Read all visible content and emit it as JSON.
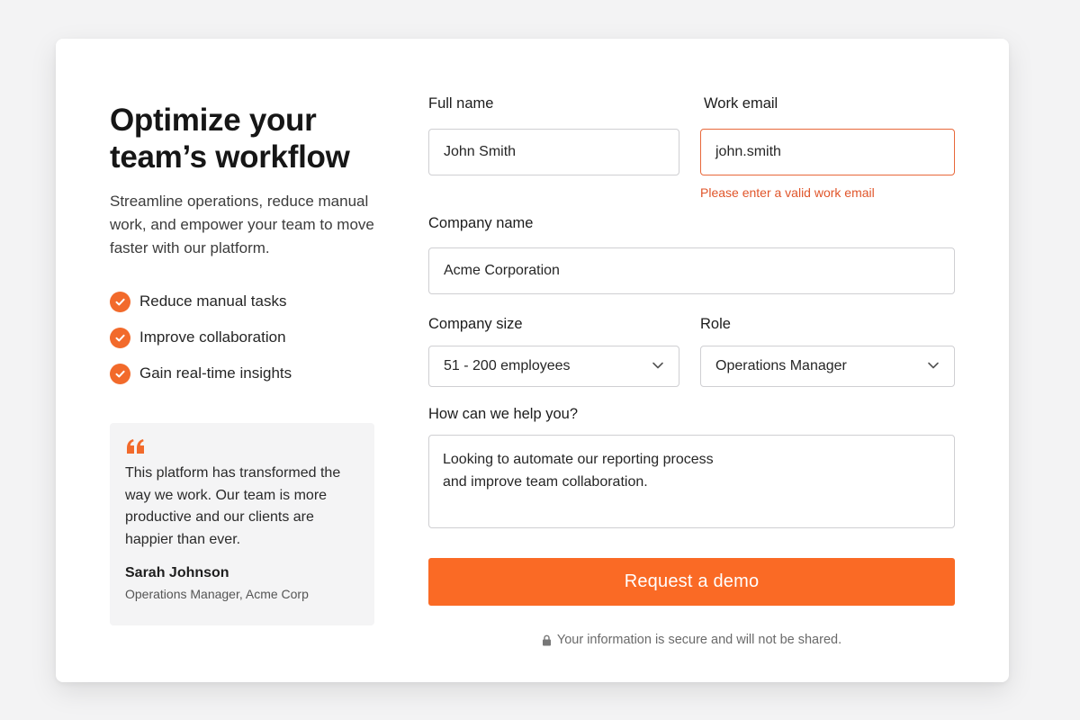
{
  "hero": {
    "headline": "Optimize your team’s workflow",
    "subtext": "Streamline operations, reduce manual work, and empower your team to move faster with our platform.",
    "benefits": [
      "Reduce manual tasks",
      "Improve collaboration",
      "Gain real-time insights"
    ]
  },
  "testimonial": {
    "icon": "quote-icon",
    "quote": "This platform has transformed the way we work. Our team is more productive and our clients are happier than ever.",
    "author": "Sarah Johnson",
    "author_title": "Operations Manager, Acme Corp"
  },
  "form": {
    "full_name": {
      "label": "Full name",
      "value": "John Smith"
    },
    "work_email": {
      "label": "Work email",
      "value": "john.smith",
      "error": "Please enter a valid work email"
    },
    "company_name": {
      "label": "Company name",
      "value": "Acme Corporation"
    },
    "company_size": {
      "label": "Company size",
      "selected": "51 - 200 employees"
    },
    "role": {
      "label": "Role",
      "selected": "Operations Manager"
    },
    "message": {
      "label": "How can we help you?",
      "value": "Looking to automate our reporting process\nand improve team collaboration."
    },
    "submit_label": "Request a demo",
    "secure_note": "Your information is secure and will not be shared."
  },
  "colors": {
    "accent": "#fa6a25",
    "error": "#e0552a",
    "border": "#cfcfd2"
  }
}
